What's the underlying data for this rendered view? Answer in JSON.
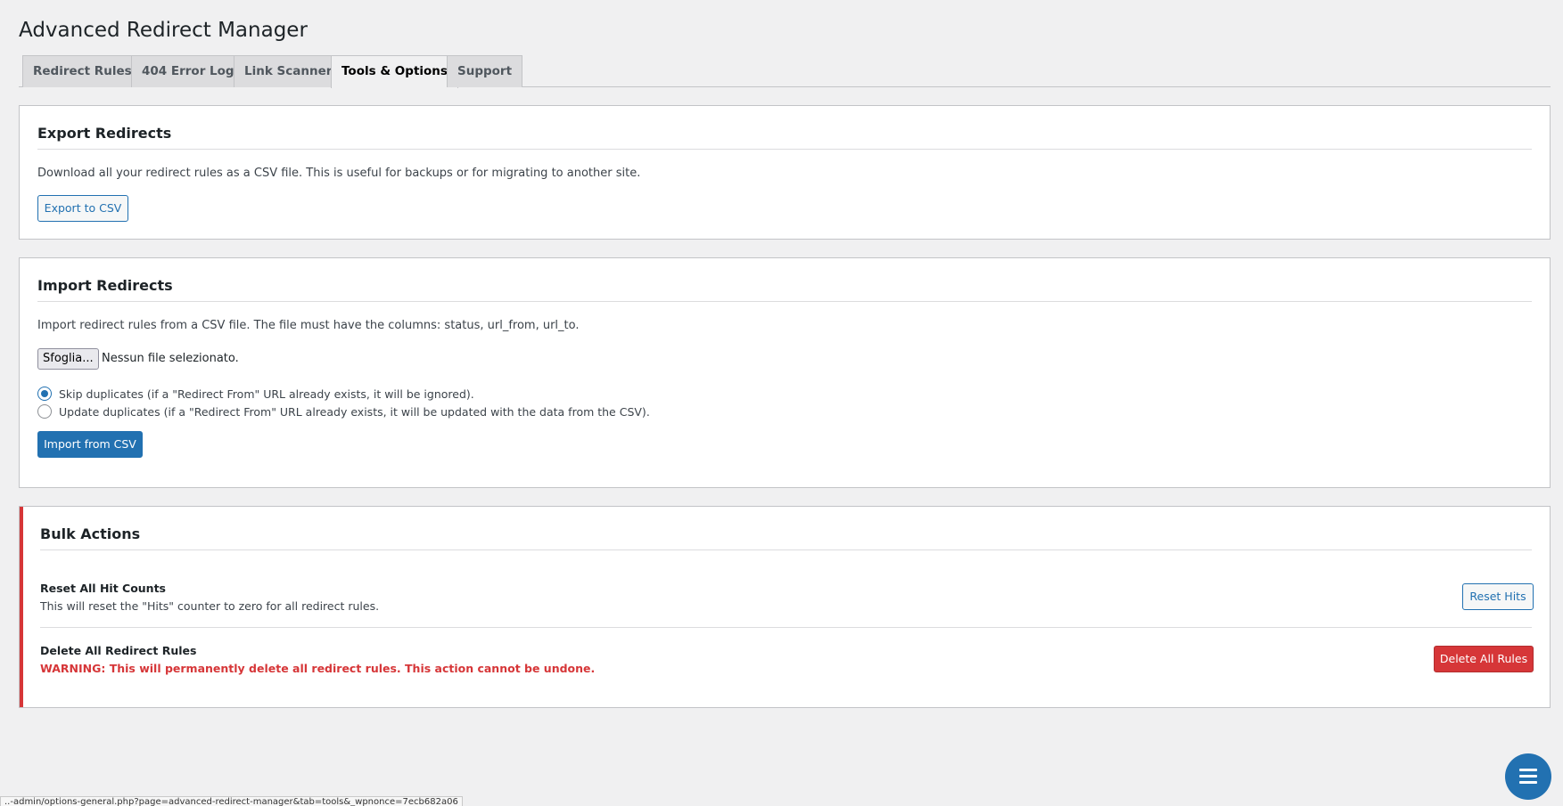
{
  "page": {
    "title": "Advanced Redirect Manager"
  },
  "tabs": [
    {
      "label": "Redirect Rules",
      "active": false
    },
    {
      "label": "404 Error Log",
      "active": false
    },
    {
      "label": "Link Scanner",
      "active": false
    },
    {
      "label": "Tools & Options",
      "active": true
    },
    {
      "label": "Support",
      "active": false
    }
  ],
  "export": {
    "title": "Export Redirects",
    "description": "Download all your redirect rules as a CSV file. This is useful for backups or for migrating to another site.",
    "button_label": "Export to CSV"
  },
  "import": {
    "title": "Import Redirects",
    "description": "Import redirect rules from a CSV file. The file must have the columns: status, url_from, url_to.",
    "file_button_label": "Sfoglia...",
    "file_status": "Nessun file selezionato.",
    "options": [
      {
        "label": "Skip duplicates (if a \"Redirect From\" URL already exists, it will be ignored).",
        "checked": true
      },
      {
        "label": "Update duplicates (if a \"Redirect From\" URL already exists, it will be updated with the data from the CSV).",
        "checked": false
      }
    ],
    "button_label": "Import from CSV"
  },
  "bulk": {
    "title": "Bulk Actions",
    "reset": {
      "title": "Reset All Hit Counts",
      "description": "This will reset the \"Hits\" counter to zero for all redirect rules.",
      "button_label": "Reset Hits"
    },
    "delete": {
      "title": "Delete All Redirect Rules",
      "warning": "WARNING: This will permanently delete all redirect rules. This action cannot be undone.",
      "button_label": "Delete All Rules"
    }
  },
  "statusbar": {
    "text": "..-admin/options-general.php?page=advanced-redirect-manager&tab=tools&_wpnonce=7ecb682a06"
  },
  "fab": {
    "icon": "menu-icon"
  },
  "colors": {
    "accent": "#2271b1",
    "danger": "#d63638",
    "background": "#f0f0f1"
  }
}
